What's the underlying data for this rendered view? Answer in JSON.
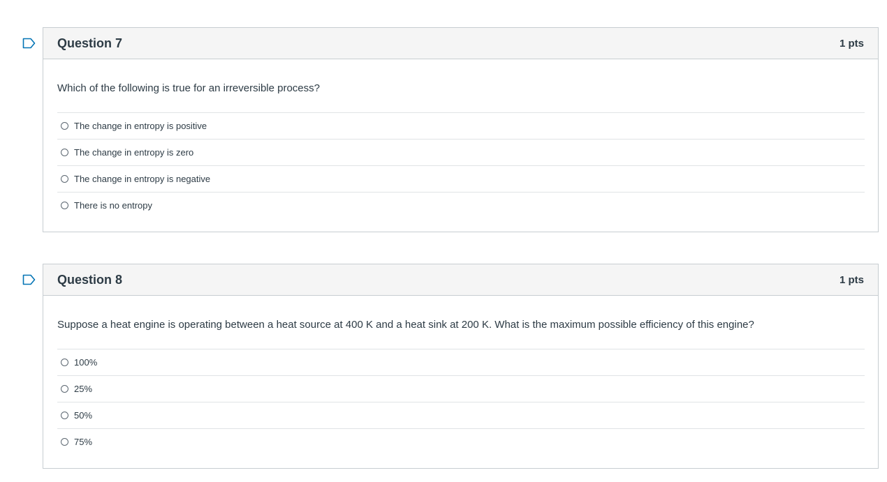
{
  "questions": [
    {
      "title": "Question 7",
      "points": "1 pts",
      "text": "Which of the following is true for an irreversible process?",
      "answers": [
        "The change in entropy is positive",
        "The change in entropy is zero",
        "The change in entropy is negative",
        "There is no entropy"
      ]
    },
    {
      "title": "Question 8",
      "points": "1 pts",
      "text": "Suppose a heat engine is operating between a heat source at 400 K and a heat sink at 200 K. What is the maximum possible efficiency of this engine?",
      "answers": [
        "100%",
        "25%",
        "50%",
        "75%"
      ]
    }
  ],
  "colors": {
    "flag": "#0374b5",
    "header_bg": "#f5f5f5",
    "border": "#c7cdd1",
    "text": "#2d3b45"
  }
}
